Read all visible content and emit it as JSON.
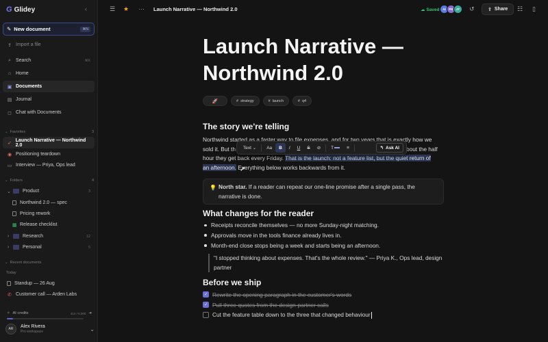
{
  "app": {
    "name": "Glidey"
  },
  "sidebar": {
    "new_doc": {
      "label": "New document",
      "shortcut": "⌘N"
    },
    "import": "Import a file",
    "nav": [
      {
        "label": "Search",
        "shortcut": "⌘K"
      },
      {
        "label": "Home"
      },
      {
        "label": "Documents"
      },
      {
        "label": "Journal"
      },
      {
        "label": "Chat with Documents"
      }
    ],
    "favorites": {
      "title": "Favorites",
      "count": "3",
      "items": [
        "Launch Narrative — Northwind 2.0",
        "Positioning teardown",
        "Interview — Priya, Ops lead"
      ]
    },
    "folders": {
      "title": "Folders",
      "count": "4",
      "product": {
        "label": "Product",
        "count": "3",
        "items": [
          "Northwind 2.0 — spec",
          "Pricing rework",
          "Release checklist"
        ]
      },
      "research": {
        "label": "Research",
        "count": "12"
      },
      "personal": {
        "label": "Personal",
        "count": "5"
      }
    },
    "recent": {
      "title": "Recent documents",
      "today": "Today",
      "items": [
        "Standup — 26 Aug",
        "Customer call — Arden Labs"
      ]
    },
    "credits": {
      "label": "AI credits",
      "value": "412 / 5,000",
      "fraction": 0.08
    },
    "user": {
      "initials": "AR",
      "name": "Alex Rivera",
      "workspace": "Pro workspace"
    }
  },
  "topbar": {
    "title": "Launch Narrative — Northwind 2.0",
    "saved": "Saved",
    "collaborators": [
      {
        "initials": "AI",
        "color": "#5b7be0"
      },
      {
        "initials": "PK",
        "color": "#8a6fd1"
      },
      {
        "initials": "JT",
        "color": "#3ba99c"
      }
    ],
    "share": "Share"
  },
  "doc": {
    "title": "Launch Narrative — Northwind 2.0",
    "tags": [
      "strategy",
      "launch",
      "q4"
    ],
    "emoji": "🚀",
    "h_story": "The story we're telling",
    "p1_a": "Northwind st",
    "p1_hidden": "arted as a faster way to file expenses, and for two years that is exactly how we",
    "p1_b": "sold it. But th",
    "p1_c": "bout the half",
    "p1_d": "hour they get back every Friday. ",
    "p1_hl1": "That is the launch: not a feature list, but the quiet return of",
    "p1_hl2": "an afternoon.",
    "p1_e": " Everything below works backwards from it.",
    "callout_bold": "North star.",
    "callout_text": " If a reader can repeat our one-line promise after a single pass, the narrative is done.",
    "h_changes": "What changes for the reader",
    "bullets": [
      "Receipts reconcile themselves — no more Sunday-night matching.",
      "Approvals move in the tools finance already lives in.",
      "Month-end close stops being a week and starts being an afternoon."
    ],
    "quote": "\"I stopped thinking about expenses. That's the whole review.\" — Priya K., Ops lead, design partner",
    "h_ship": "Before we ship",
    "todos": [
      {
        "text": "Rewrite the opening paragraph in the customer's words",
        "done": true
      },
      {
        "text": "Pull three quotes from the design-partner calls",
        "done": true
      },
      {
        "text": "Cut the feature table down to the three that changed behaviour",
        "done": false
      }
    ]
  },
  "toolbar": {
    "text": "Text",
    "font": "Aa",
    "bold": "B",
    "italic": "I",
    "underline": "U",
    "strike": "S",
    "link": "⊘",
    "color": "T",
    "align": "≡",
    "ask_ai": "Ask AI"
  }
}
